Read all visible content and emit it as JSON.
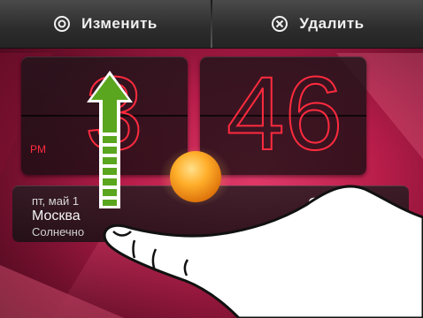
{
  "topbar": {
    "edit_label": "Изменить",
    "delete_label": "Удалить"
  },
  "clock": {
    "hours": "3",
    "minutes": "46",
    "ampm": "PM"
  },
  "weather": {
    "date": "пт, май 1",
    "city": "Москва",
    "condition": "Солнечно",
    "temp": "2"
  },
  "colors": {
    "digit": "#ff2b3f",
    "arrow": "#5aa61e",
    "background": "#c4224f"
  }
}
